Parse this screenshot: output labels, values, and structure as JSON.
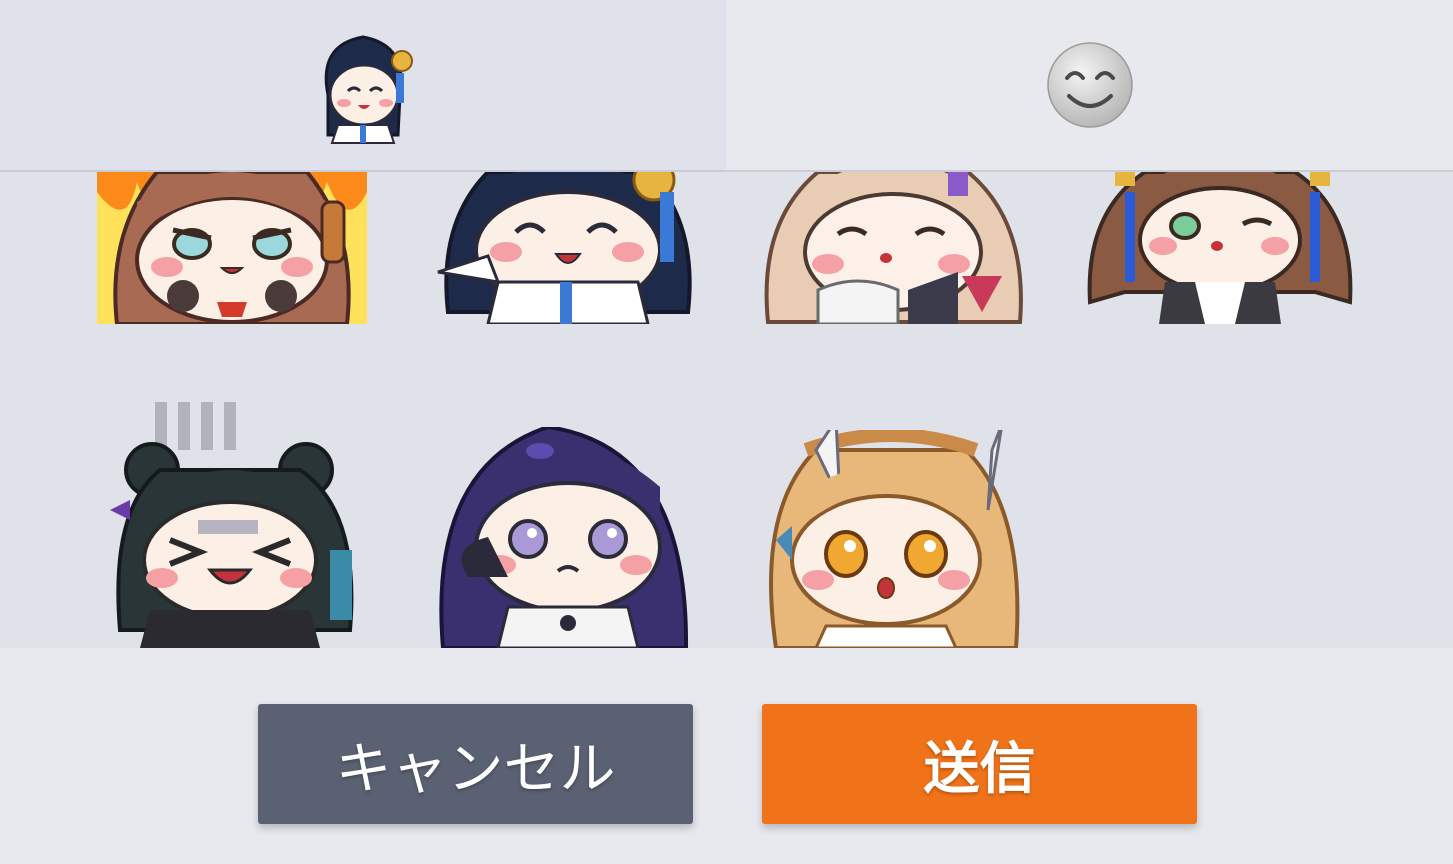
{
  "tabs": [
    {
      "name": "sticker-pack-tab",
      "icon": "chibi-girl-sticker-icon",
      "selected": true
    },
    {
      "name": "emoji-tab",
      "icon": "smiling-face-icon",
      "selected": false
    }
  ],
  "stickers": [
    {
      "icon": "chibi-brown-hair-angry-fire-sticker"
    },
    {
      "icon": "chibi-navy-hair-cheering-sticker"
    },
    {
      "icon": "chibi-blonde-hair-sipping-sticker"
    },
    {
      "icon": "chibi-brown-twintail-shy-sticker"
    },
    {
      "icon": "chibi-dark-bun-hair-crying-sticker"
    },
    {
      "icon": "chibi-purple-hair-pout-sticker"
    },
    {
      "icon": "chibi-blonde-braid-surprised-sticker"
    }
  ],
  "footer": {
    "cancel_label": "キャンセル",
    "send_label": "送信"
  },
  "colors": {
    "cancel": "#5a6173",
    "send": "#f07319",
    "tab_active_bg": "#dfe2ea",
    "tab_inactive_bg": "#e8e9ee"
  }
}
